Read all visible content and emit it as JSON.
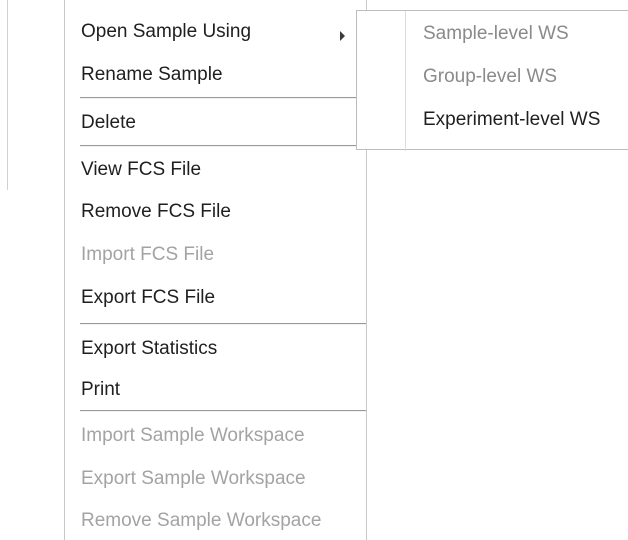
{
  "menu": {
    "open_with": "Open Sample Using",
    "rename": "Rename Sample",
    "delete": "Delete",
    "view_fcs": "View FCS File",
    "remove_fcs": "Remove FCS File",
    "import_fcs": "Import FCS File",
    "export_fcs": "Export FCS File",
    "export_stats": "Export Statistics",
    "print": "Print",
    "import_ws": "Import Sample Workspace",
    "export_ws": "Export Sample Workspace",
    "remove_ws": "Remove Sample Workspace"
  },
  "submenu": {
    "sample_ws": "Sample-level WS",
    "group_ws": "Group-level WS",
    "experiment_ws": "Experiment-level WS"
  },
  "icons": {
    "submenu_arrow": "chevron-right-icon"
  },
  "colors": {
    "text": "#1f1f1f",
    "disabled_text": "#a3a3a3",
    "submenu_dim_text": "#8a8a8a",
    "separator": "#9a9a9a"
  }
}
